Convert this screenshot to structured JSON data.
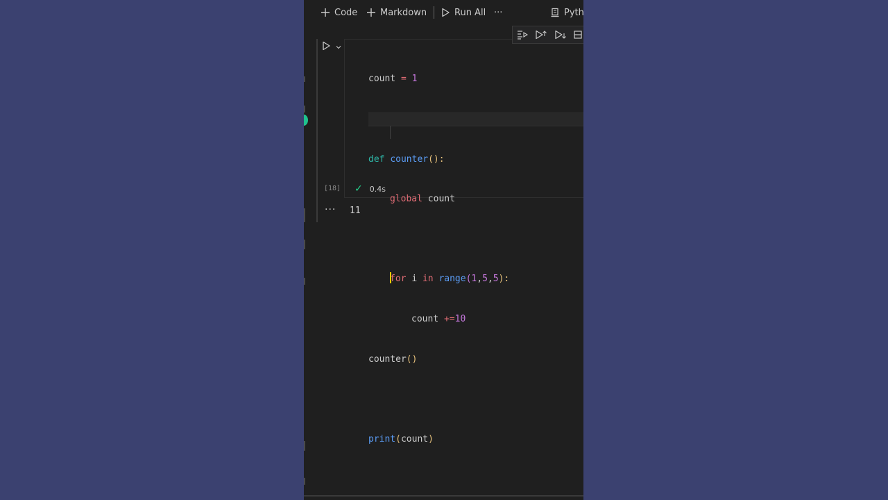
{
  "toolbar": {
    "add_code_label": "Code",
    "add_markdown_label": "Markdown",
    "run_all_label": "Run All",
    "more_label": "···",
    "kernel_label": "Pyth"
  },
  "cell": {
    "execution_count": "[18]",
    "duration": "0.4s",
    "status": "success",
    "code_lines": [
      "count = 1",
      "",
      "def counter():",
      "    global count",
      "",
      "    for i in range(1,5,5):",
      "        count +=10",
      "counter()",
      "",
      "print(count)"
    ],
    "output": {
      "more_label": "···",
      "value": "11"
    }
  },
  "tokens": {
    "l1_var": "count",
    "l1_op": "=",
    "l1_num": "1",
    "l3_def": "def",
    "l3_fn": "counter",
    "l3_paren": "():",
    "l4_global": "global",
    "l4_var": "count",
    "l6_for": "for",
    "l6_var": "i",
    "l6_in": "in",
    "l6_fn": "range",
    "l6_open": "(",
    "l6_n1": "1",
    "l6_c1": ",",
    "l6_n2": "5",
    "l6_c2": ",",
    "l6_n3": "5",
    "l6_close": "):",
    "l7_var": "count",
    "l7_op": "+=",
    "l7_num": "10",
    "l8_fn": "counter",
    "l8_paren": "()",
    "l10_fn": "print",
    "l10_open": "(",
    "l10_var": "count",
    "l10_close": ")"
  },
  "colors": {
    "background_outer": "#3b4170",
    "editor_bg": "#1f1f1f",
    "keyword_teal": "#2eb5a6",
    "keyword_red": "#e06c75",
    "function_blue": "#5b9cf4",
    "number_purple": "#c678dd",
    "success_green": "#23d18b"
  }
}
